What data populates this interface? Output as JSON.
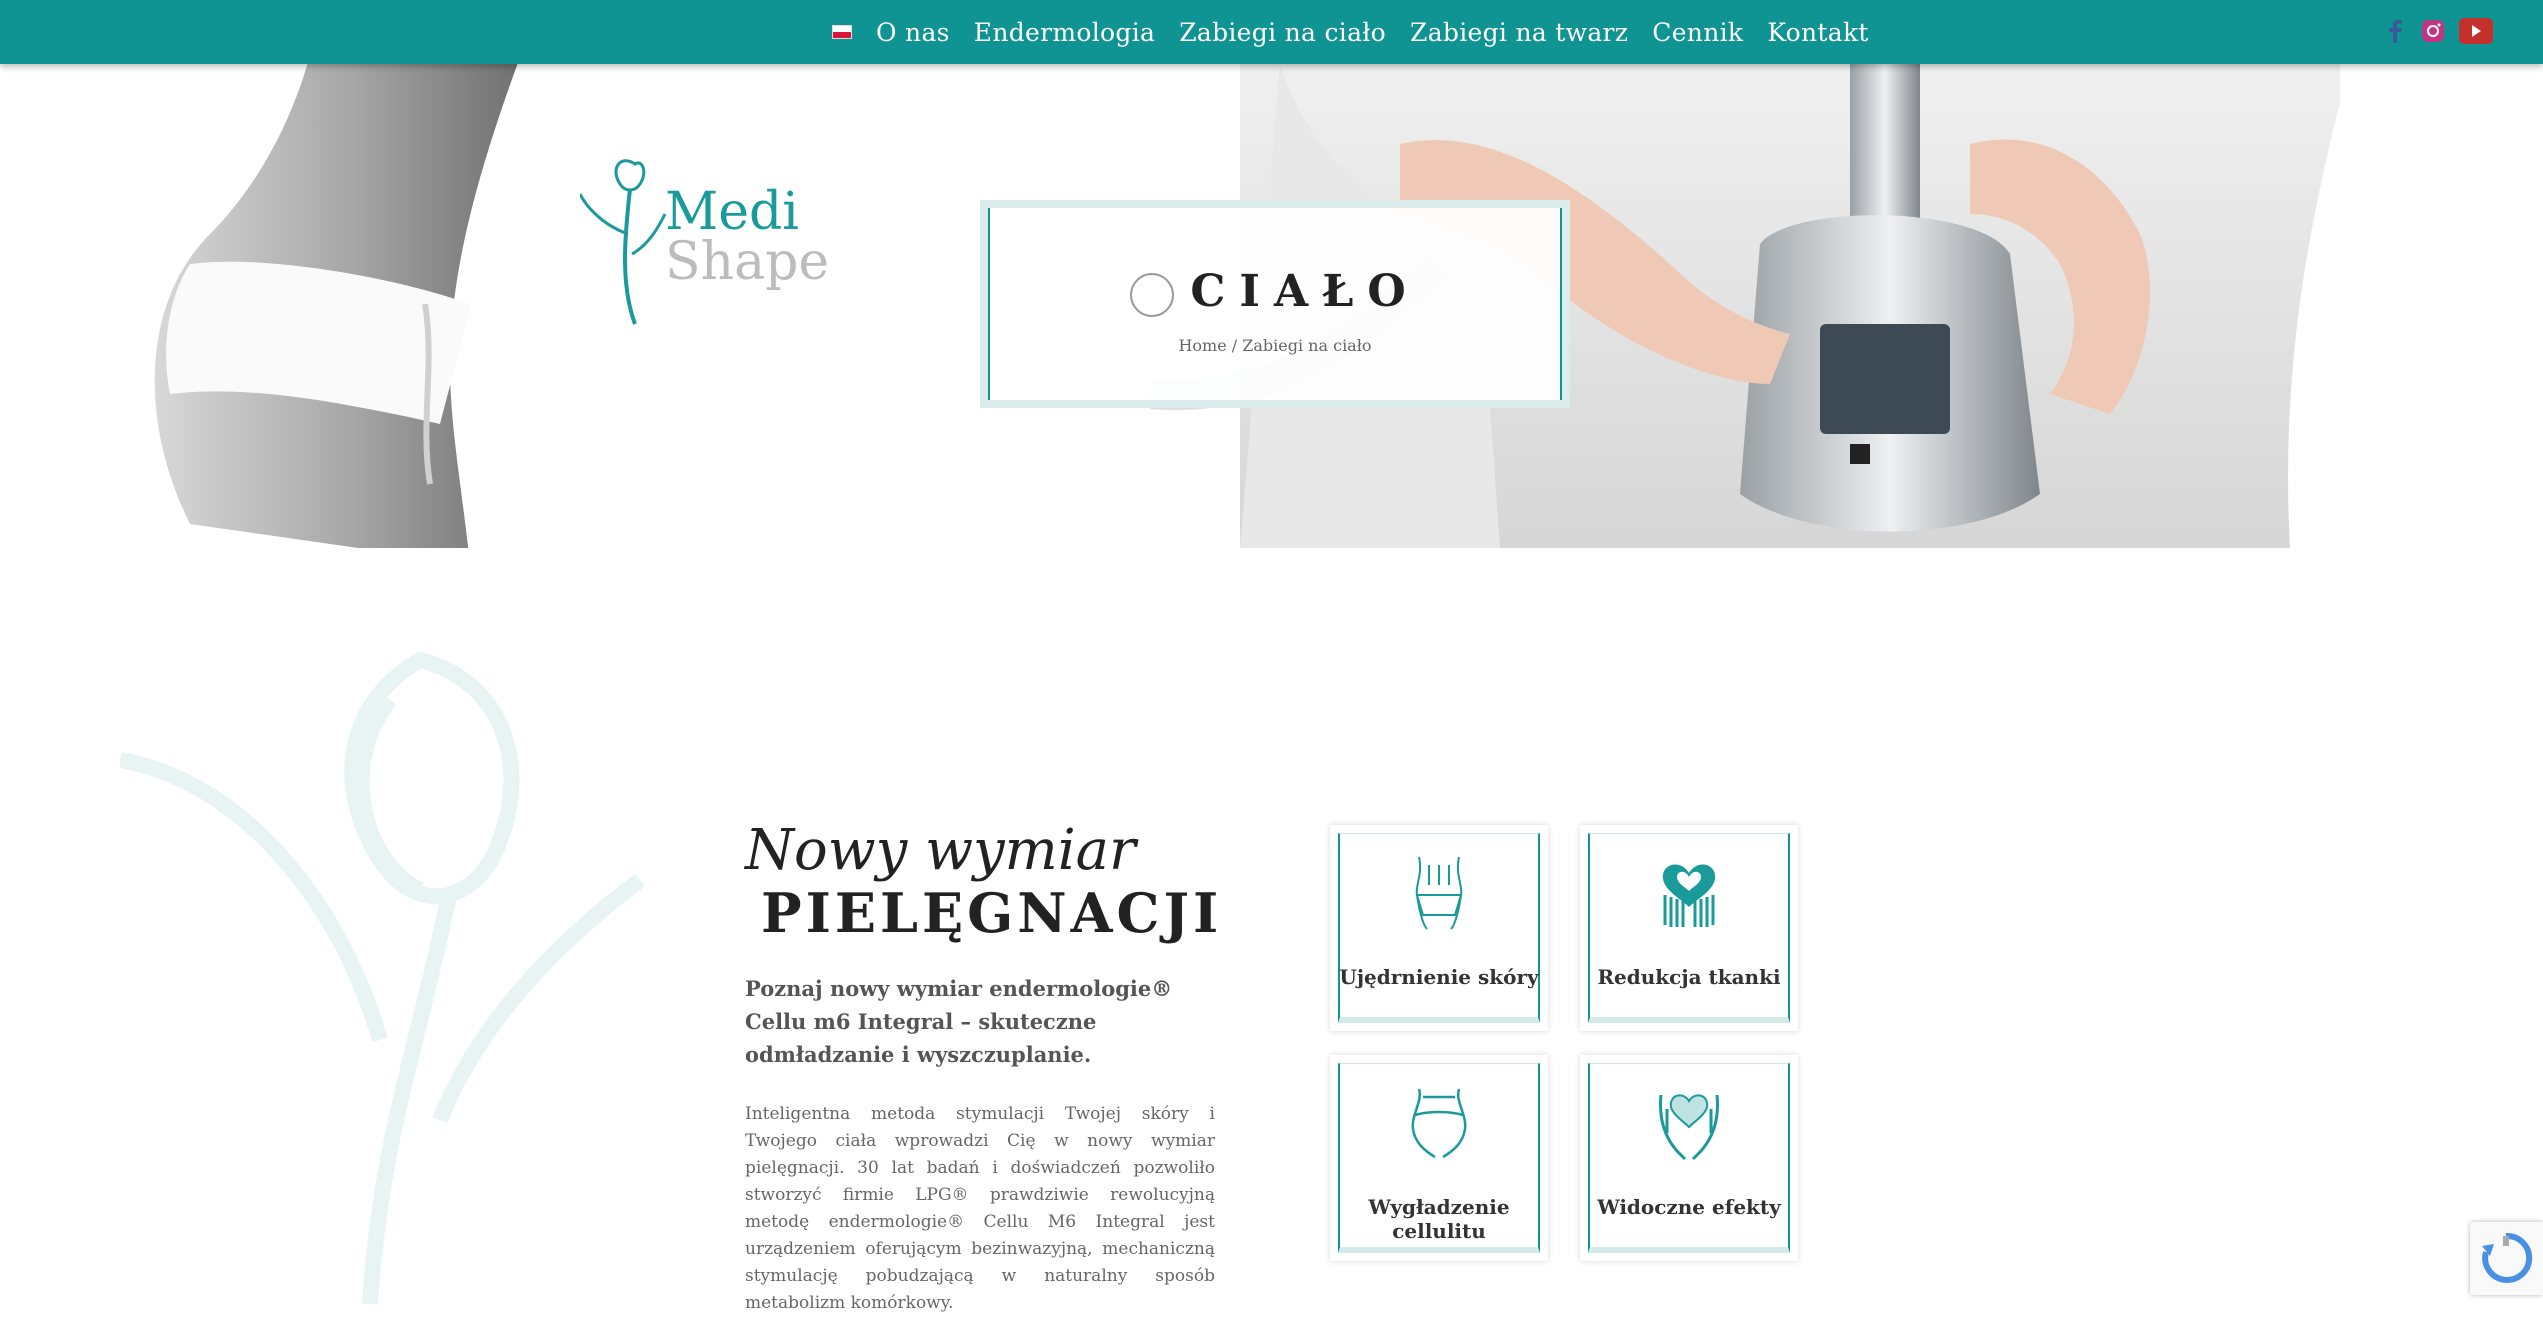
{
  "nav": {
    "items": [
      "O nas",
      "Endermologia",
      "Zabiegi na ciało",
      "Zabiegi na twarz",
      "Cennik",
      "Kontakt"
    ]
  },
  "social": {
    "icons": [
      "facebook-icon",
      "instagram-icon",
      "youtube-icon"
    ]
  },
  "colors": {
    "brand": "#0f9393",
    "brand_light": "#dcecec",
    "text_dark": "#222222"
  },
  "logo": {
    "line1": "Medi",
    "line2": "Shape"
  },
  "hero": {
    "title": "CIAŁO",
    "breadcrumb": "Home / Zabiegi na ciało"
  },
  "intro": {
    "heading_italic": "Nowy wymiar",
    "heading_bold": "PIELĘGNACJI",
    "lead": "Poznaj nowy wymiar endermologie® Cellu m6 Integral – skuteczne odmładzanie i wyszczuplanie.",
    "description": "Inteligentna metoda stymulacji Twojej skóry i Twojego ciała wprowadzi Cię w nowy wymiar pielęgnacji. 30 lat badań i doświadczeń pozwoliło stworzyć firmie LPG® prawdziwie rewolucyjną metodę endermologie® Cellu M6 Integral jest urządzeniem oferującym bezinwazyjną, mechaniczną stymulację pobudzającą w naturalny sposób metabolizm komórkowy."
  },
  "features": [
    {
      "label": "Ujędrnienie skóry",
      "icon": "body-silhouette-icon"
    },
    {
      "label": "Redukcja tkanki",
      "icon": "heart-hands-icon"
    },
    {
      "label": "Wygładzenie cellulitu",
      "icon": "hips-silhouette-icon"
    },
    {
      "label": "Widoczne efekty",
      "icon": "hands-heart-icon"
    }
  ]
}
